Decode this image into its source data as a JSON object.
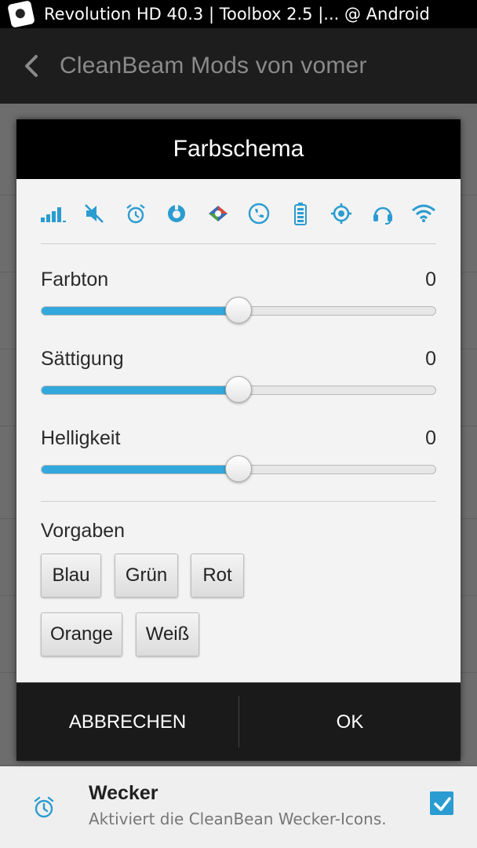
{
  "status_bar": {
    "title": "Revolution HD 40.3 | Toolbox 2.5 |... @ Android",
    "app_icon": "app-launcher-icon"
  },
  "action_bar": {
    "back_icon": "back-arrow-icon",
    "title": "CleanBeam Mods von vomer"
  },
  "dialog": {
    "title": "Farbschema",
    "preview_icons": [
      "signal-bars-icon",
      "mute-icon",
      "alarm-clock-icon",
      "sync-icon",
      "bluetooth-icon",
      "phone-call-icon",
      "battery-icon",
      "gps-icon",
      "headset-icon",
      "wifi-icon"
    ],
    "sliders": [
      {
        "label": "Farbton",
        "value": "0",
        "level": 0.5
      },
      {
        "label": "Sättigung",
        "value": "0",
        "level": 0.5
      },
      {
        "label": "Helligkeit",
        "value": "0",
        "level": 0.5
      }
    ],
    "presets_label": "Vorgaben",
    "presets": [
      "Blau",
      "Grün",
      "Rot",
      "Orange",
      "Weiß"
    ],
    "cancel_label": "ABBRECHEN",
    "ok_label": "OK"
  },
  "background_item": {
    "icon": "alarm-clock-icon",
    "title": "Wecker",
    "subtitle": "Aktiviert die CleanBean Wecker-Icons.",
    "checked": true
  },
  "colors": {
    "accent": "#32a8dc",
    "icon_blue": "#2b9cd1",
    "dialog_header": "#000000",
    "action_bar": "#1d1d1d"
  }
}
